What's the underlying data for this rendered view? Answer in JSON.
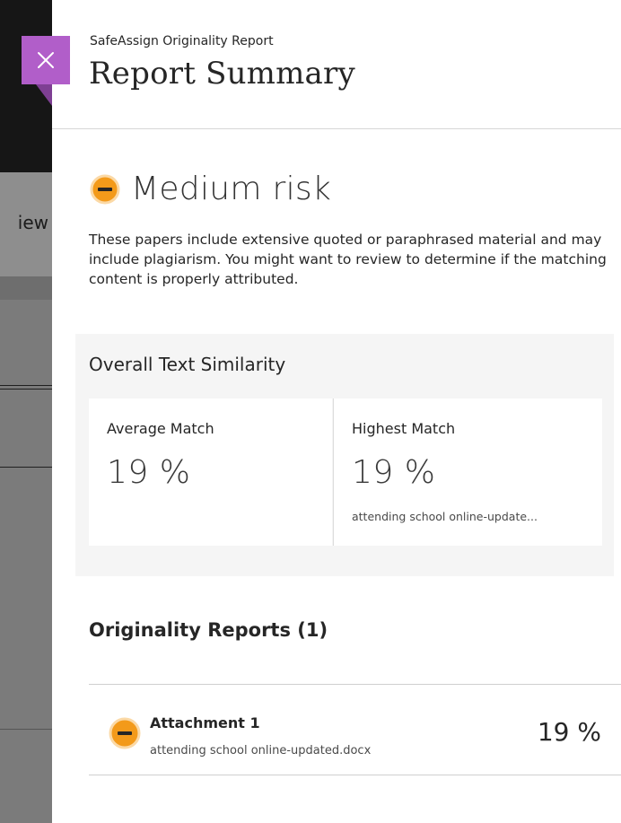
{
  "header": {
    "label": "SafeAssign Originality Report",
    "title": "Report Summary"
  },
  "background": {
    "partial_text": "iew"
  },
  "risk": {
    "title": "Medium risk",
    "description": "These papers include extensive quoted or paraphrased material and may include plagiarism. You might want to review to determine if the matching content is properly attributed.",
    "icon": "minus-circle-icon",
    "color": "#f39a1a"
  },
  "similarity": {
    "title": "Overall Text Similarity",
    "average": {
      "label": "Average Match",
      "value": "19 %"
    },
    "highest": {
      "label": "Highest Match",
      "value": "19 %",
      "file": "attending school online-update..."
    }
  },
  "originality": {
    "title": "Originality Reports (1)",
    "items": [
      {
        "name": "Attachment 1",
        "file": "attending school online-updated.docx",
        "percent": "19 %",
        "icon": "minus-circle-icon"
      }
    ]
  },
  "colors": {
    "accent": "#b15ec9",
    "risk_medium": "#f39a1a"
  }
}
